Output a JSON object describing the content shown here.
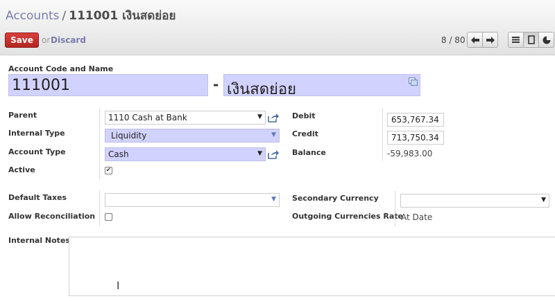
{
  "breadcrumb": {
    "parent": "Accounts",
    "separator": "/",
    "current": "111001 เงินสดย่อย"
  },
  "toolbar": {
    "save_label": "Save",
    "or_label": "or",
    "discard_label": "Discard",
    "pager": "8 / 80"
  },
  "form": {
    "code_name_label": "Account Code and Name",
    "code_value": "111001",
    "dash": "-",
    "name_value": "เงินสดย่อย",
    "parent_label": "Parent",
    "parent_value": "1110 Cash at Bank",
    "internal_type_label": "Internal Type",
    "internal_type_value": "Liquidity",
    "account_type_label": "Account Type",
    "account_type_value": "Cash",
    "active_label": "Active",
    "active_checked": true,
    "debit_label": "Debit",
    "debit_value": "653,767.34",
    "credit_label": "Credit",
    "credit_value": "713,750.34",
    "balance_label": "Balance",
    "balance_value": "-59,983.00",
    "default_taxes_label": "Default Taxes",
    "default_taxes_value": "",
    "allow_reconciliation_label": "Allow Reconciliation",
    "allow_reconciliation_checked": false,
    "secondary_currency_label": "Secondary Currency",
    "secondary_currency_value": "",
    "outgoing_rate_label": "Outgoing Currencies Rate",
    "outgoing_rate_value": "At Date",
    "internal_notes_label": "Internal Notes",
    "internal_notes_value": ""
  },
  "colors": {
    "required_field": "#d2d2ff",
    "save_button": "#c8312e",
    "link": "#7c7bad"
  },
  "icons": [
    "arrow-left-icon",
    "arrow-right-icon",
    "list-view-icon",
    "form-view-icon",
    "graph-view-icon",
    "external-link-icon",
    "translate-icon",
    "text-cursor-icon"
  ]
}
